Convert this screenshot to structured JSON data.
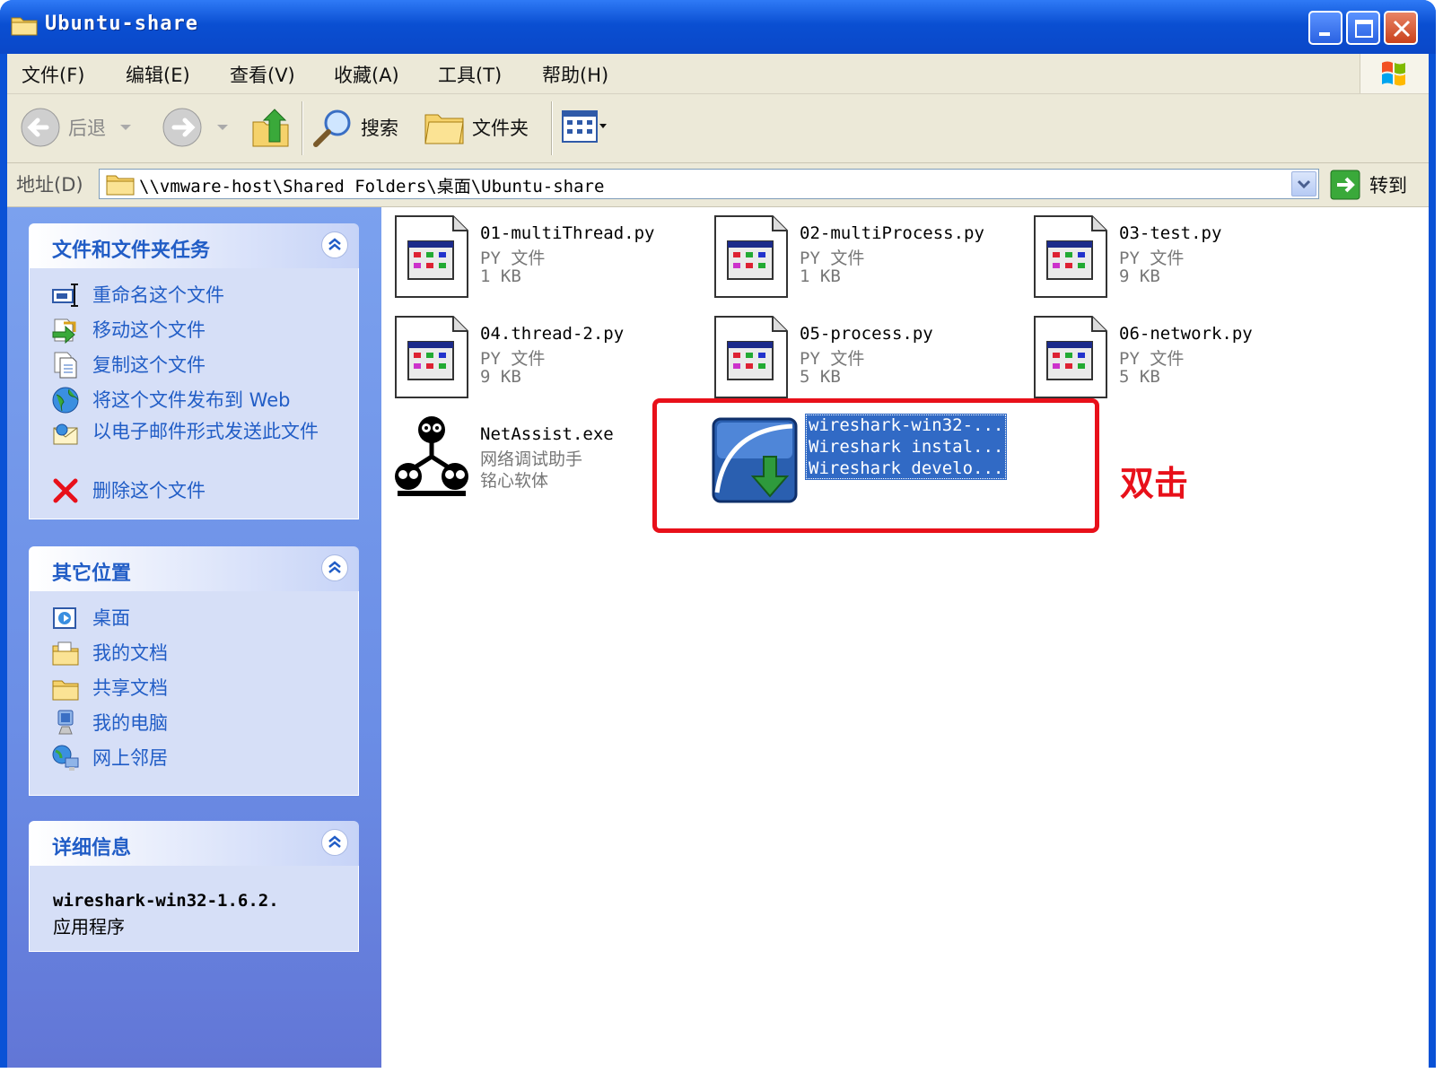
{
  "window": {
    "title": "Ubuntu-share"
  },
  "menu": [
    "文件(F)",
    "编辑(E)",
    "查看(V)",
    "收藏(A)",
    "工具(T)",
    "帮助(H)"
  ],
  "toolbar": {
    "back_label": "后退",
    "search_label": "搜索",
    "folders_label": "文件夹"
  },
  "address": {
    "label": "地址(D)",
    "path": "\\\\vmware-host\\Shared Folders\\桌面\\Ubuntu-share",
    "go_label": "转到"
  },
  "tasks_panel": {
    "title": "文件和文件夹任务",
    "items": [
      {
        "label": "重命名这个文件",
        "icon": "rename-icon"
      },
      {
        "label": "移动这个文件",
        "icon": "move-icon"
      },
      {
        "label": "复制这个文件",
        "icon": "copy-icon"
      },
      {
        "label": "将这个文件发布到 Web",
        "icon": "globe-icon"
      },
      {
        "label": "以电子邮件形式发送此文件",
        "icon": "email-icon"
      },
      {
        "label": "删除这个文件",
        "icon": "delete-icon"
      }
    ]
  },
  "places_panel": {
    "title": "其它位置",
    "items": [
      {
        "label": "桌面",
        "icon": "desktop-icon"
      },
      {
        "label": "我的文档",
        "icon": "my-documents-icon"
      },
      {
        "label": "共享文档",
        "icon": "shared-folder-icon"
      },
      {
        "label": "我的电脑",
        "icon": "my-computer-icon"
      },
      {
        "label": "网上邻居",
        "icon": "network-icon"
      }
    ]
  },
  "details_panel": {
    "title": "详细信息",
    "name": "wireshark-win32-1.6.2.",
    "type": "应用程序"
  },
  "files": [
    {
      "name": "01-multiThread.py",
      "type": "PY 文件",
      "size": "1 KB",
      "icon": "python-file-icon"
    },
    {
      "name": "02-multiProcess.py",
      "type": "PY 文件",
      "size": "1 KB",
      "icon": "python-file-icon"
    },
    {
      "name": "03-test.py",
      "type": "PY 文件",
      "size": "9 KB",
      "icon": "python-file-icon"
    },
    {
      "name": "04.thread-2.py",
      "type": "PY 文件",
      "size": "9 KB",
      "icon": "python-file-icon"
    },
    {
      "name": "05-process.py",
      "type": "PY 文件",
      "size": "5 KB",
      "icon": "python-file-icon"
    },
    {
      "name": "06-network.py",
      "type": "PY 文件",
      "size": "5 KB",
      "icon": "python-file-icon"
    },
    {
      "name": "NetAssist.exe",
      "type": "网络调试助手",
      "size": "铭心软体",
      "icon": "netassist-icon"
    }
  ],
  "selected_file": {
    "lines": [
      "wireshark-win32-...",
      "Wireshark instal...",
      "Wireshark develo..."
    ],
    "icon": "wireshark-installer-icon"
  },
  "annotation": {
    "text": "双击",
    "color": "#e8101a"
  },
  "colors": {
    "titlebar": "#0a52d6",
    "selection": "#316ac5",
    "task_link": "#215dc6"
  }
}
